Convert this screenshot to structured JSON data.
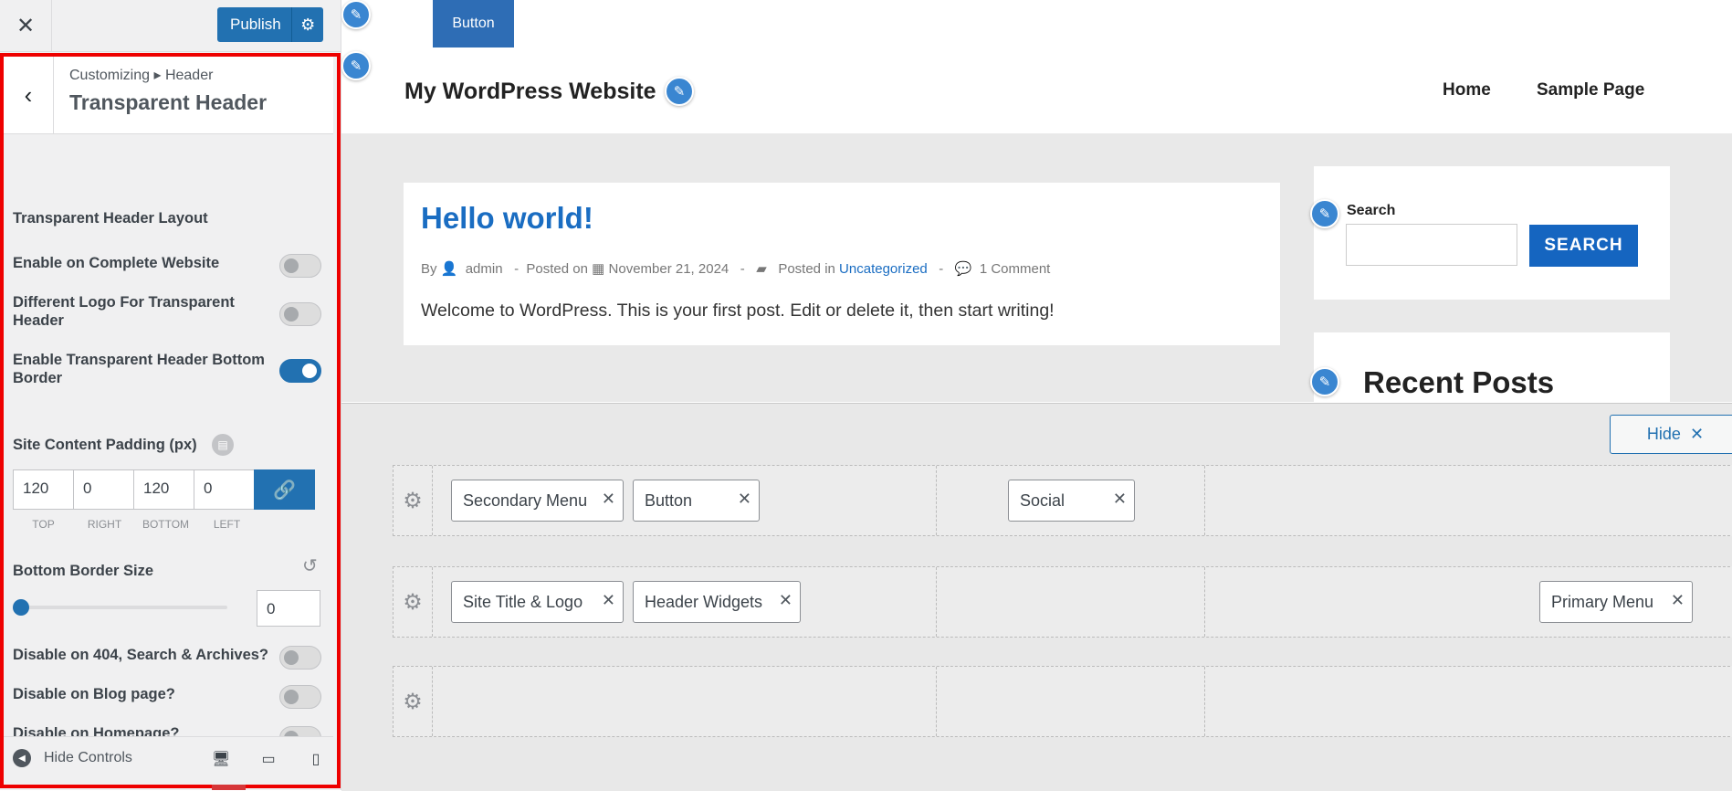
{
  "sidebar": {
    "close_glyph": "✕",
    "publish_label": "Publish",
    "breadcrumb": "Customizing ▸ Header",
    "section_title": "Transparent Header",
    "layout_heading": "Transparent Header Layout",
    "toggles": [
      {
        "label": "Enable on Complete Website",
        "on": false
      },
      {
        "label": "Different Logo For Transparent Header",
        "on": false
      },
      {
        "label": "Enable Transparent Header Bottom Border",
        "on": true
      },
      {
        "label": "Disable on 404, Search & Archives?",
        "on": false
      },
      {
        "label": "Disable on Blog page?",
        "on": false
      },
      {
        "label": "Disable on Homepage?",
        "on": false
      }
    ],
    "padding_label": "Site Content Padding (px)",
    "padding": {
      "top": "120",
      "right": "0",
      "bottom": "120",
      "left": "0"
    },
    "padding_labels": {
      "top": "TOP",
      "right": "RIGHT",
      "bottom": "BOTTOM",
      "left": "LEFT"
    },
    "border_size_label": "Bottom Border Size",
    "border_size_value": "0",
    "border_size_slider_fraction": 0,
    "footer": {
      "hide_controls": "Hide Controls"
    }
  },
  "preview": {
    "top_button": "Button",
    "site_title": "My WordPress Website",
    "nav": [
      "Home",
      "Sample Page"
    ],
    "post": {
      "title": "Hello world!",
      "by": "By",
      "author": "admin",
      "posted_on": "Posted on",
      "date": "November 21, 2024",
      "posted_in": "Posted in",
      "category": "Uncategorized",
      "comments": "1 Comment",
      "body": "Welcome to WordPress. This is your first post. Edit or delete it, then start writing!"
    },
    "search": {
      "label": "Search",
      "button": "SEARCH"
    },
    "recent_posts_title": "Recent Posts"
  },
  "builder": {
    "hide_label": "Hide",
    "rows": [
      {
        "chips_left": [
          "Secondary Menu",
          "Button"
        ],
        "chips_center": [
          "Social"
        ],
        "chips_right": []
      },
      {
        "chips_left": [
          "Site Title & Logo",
          "Header Widgets"
        ],
        "chips_center": [],
        "chips_right": [
          "Primary Menu"
        ]
      },
      {
        "chips_left": [],
        "chips_center": [],
        "chips_right": []
      }
    ]
  },
  "colors": {
    "accent": "#2271b1",
    "highlight_frame": "#ee0000",
    "link": "#1a6dc2"
  },
  "icons": [
    "close-icon",
    "gear-icon",
    "back-icon",
    "link-icon",
    "info-icon",
    "reset-icon",
    "desktop-icon",
    "tablet-icon",
    "mobile-icon",
    "pencil-icon",
    "user-icon",
    "calendar-icon",
    "folder-icon",
    "comment-icon"
  ]
}
